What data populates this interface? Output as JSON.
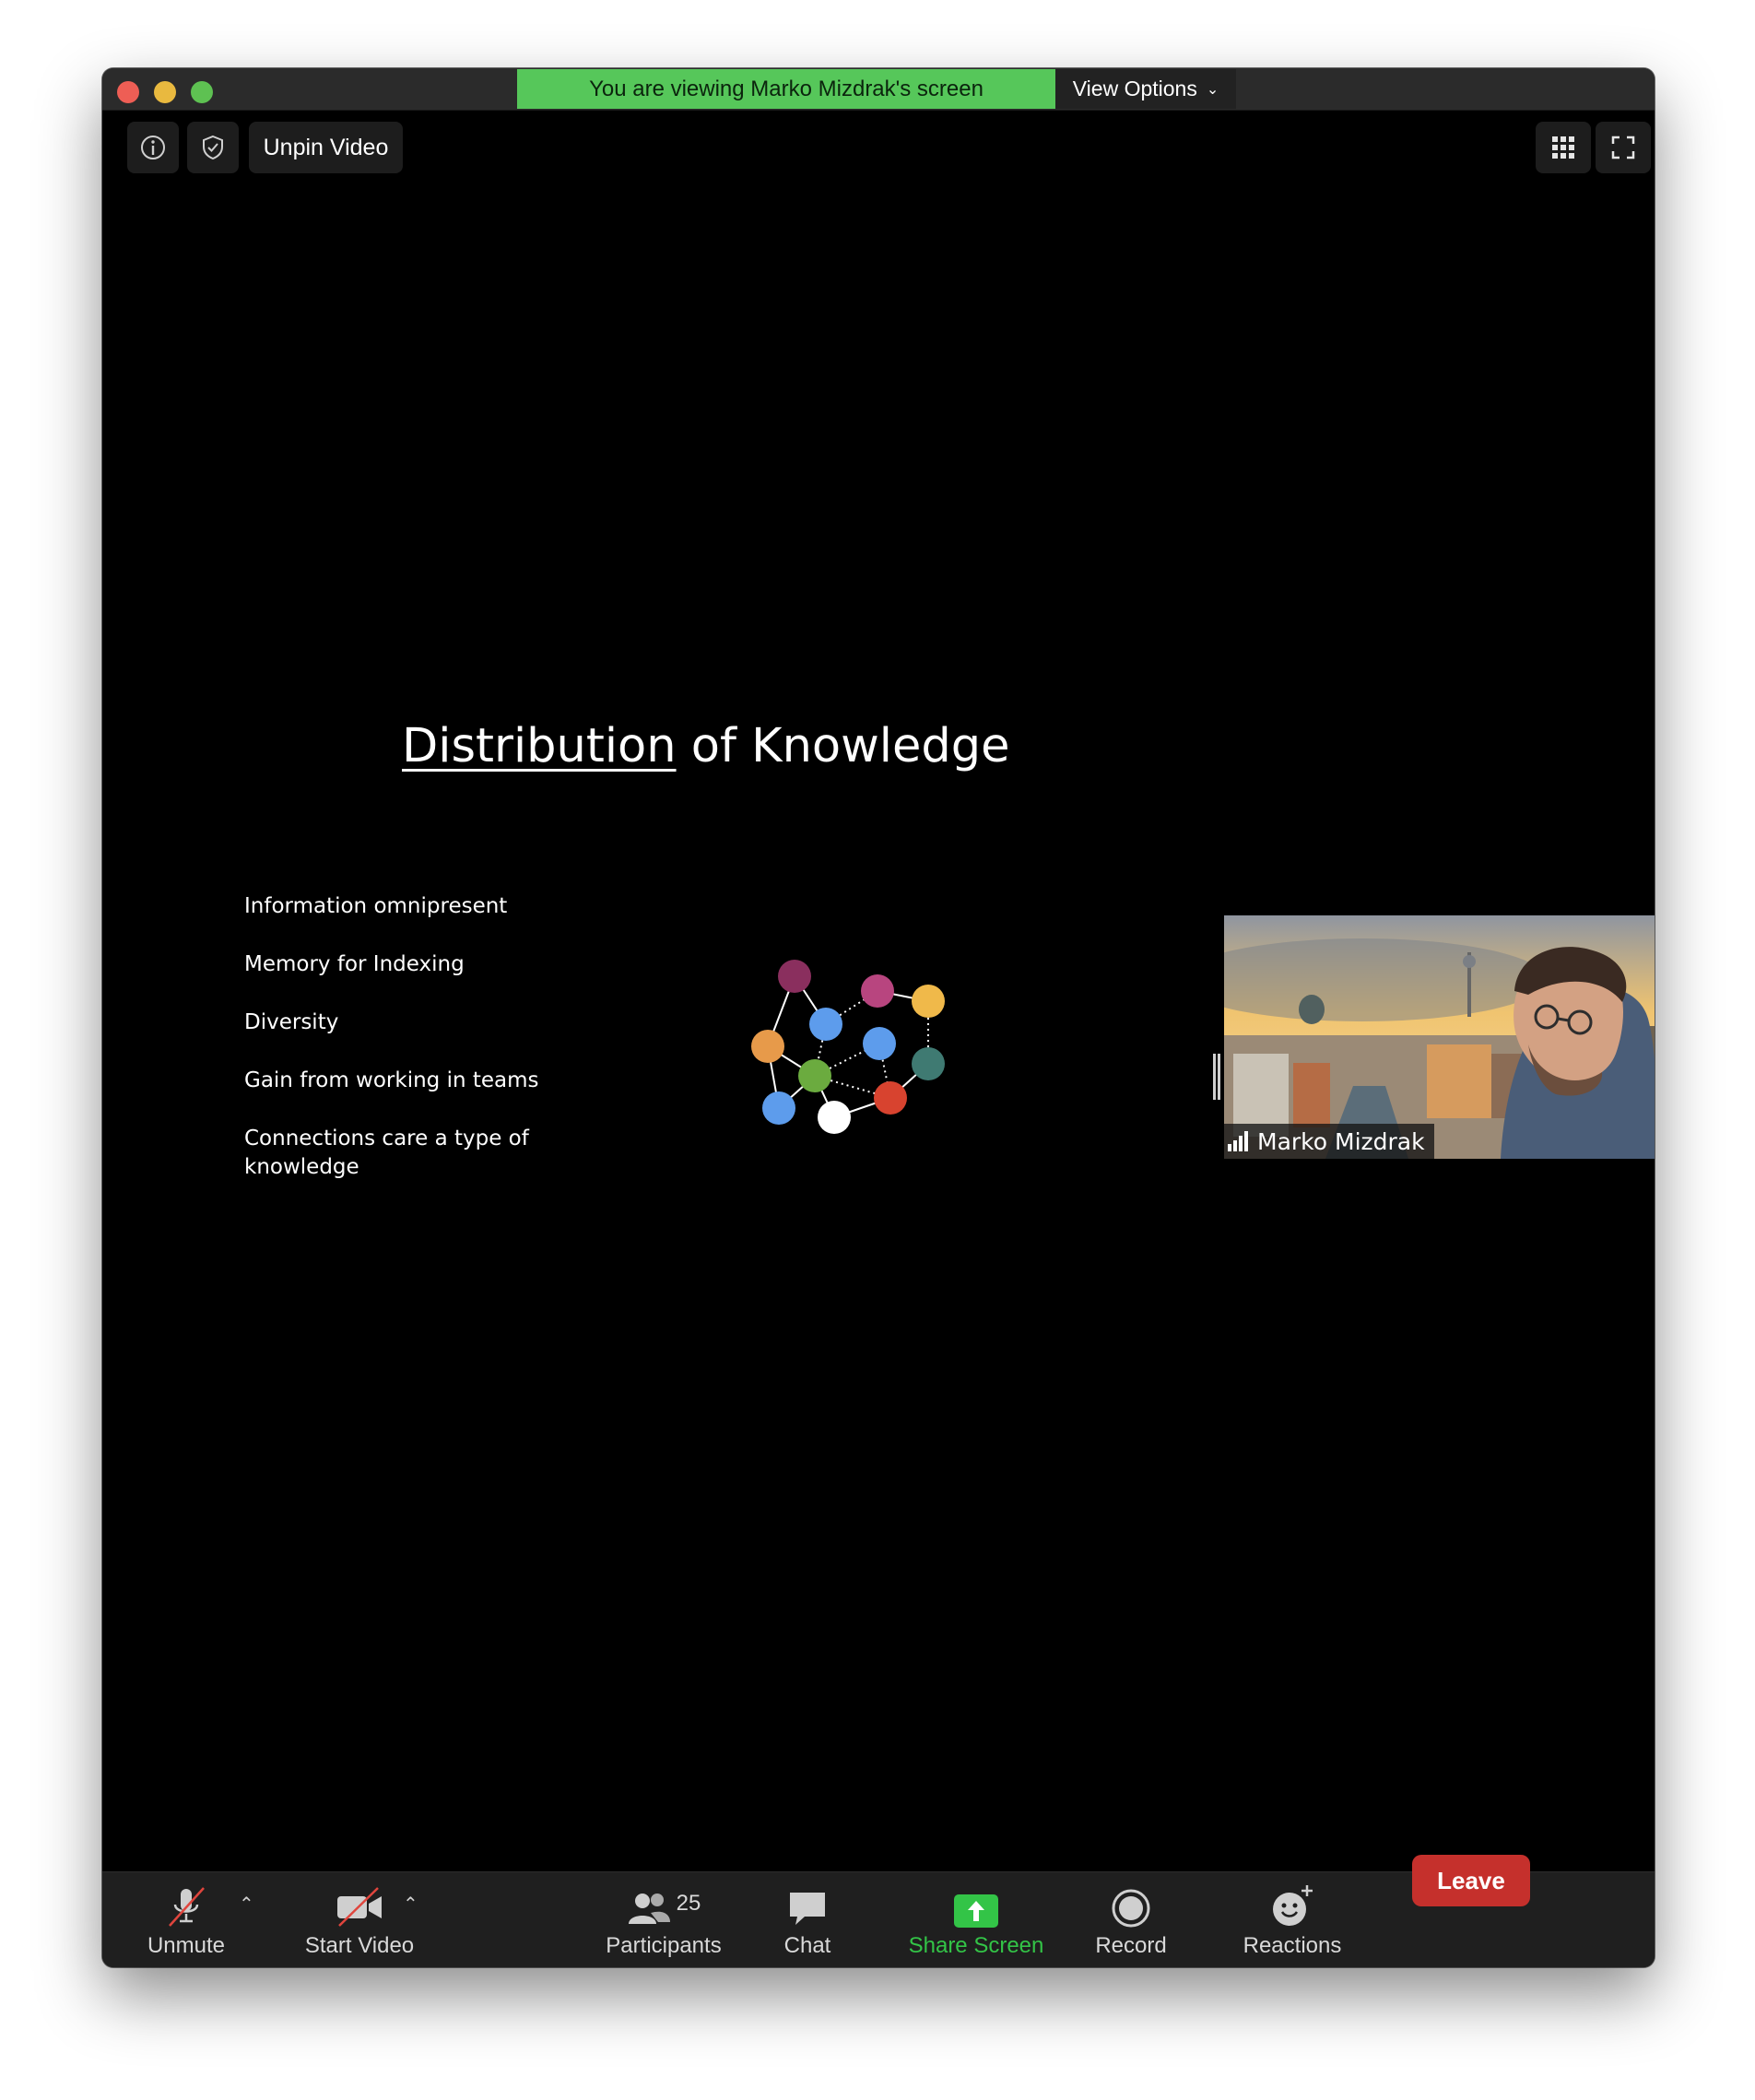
{
  "banner": {
    "viewing_text": "You are viewing Marko Mizdrak's screen",
    "view_options_label": "View Options"
  },
  "top_controls": {
    "unpin_label": "Unpin Video"
  },
  "slide": {
    "title_underlined": "Distribution",
    "title_rest": " of Knowledge",
    "bullets": [
      "Information omnipresent",
      "Memory for Indexing",
      "Diversity",
      "Gain from working in teams",
      "Connections care a type of knowledge"
    ]
  },
  "participant_tile": {
    "name": "Marko Mizdrak"
  },
  "toolbar": {
    "unmute_label": "Unmute",
    "start_video_label": "Start Video",
    "participants_label": "Participants",
    "participants_count": "25",
    "chat_label": "Chat",
    "share_screen_label": "Share Screen",
    "record_label": "Record",
    "reactions_label": "Reactions",
    "leave_label": "Leave"
  },
  "colors": {
    "banner_green": "#56c75a",
    "share_screen_green": "#33c447",
    "leave_red": "#c5302c",
    "node_colors": [
      "#8a2f5e",
      "#b8457f",
      "#f0b94a",
      "#5d9cec",
      "#e79a4a",
      "#5d9cec",
      "#3f7a72",
      "#6bab3f",
      "#d8432f",
      "#5d9cec",
      "#ffffff"
    ]
  }
}
